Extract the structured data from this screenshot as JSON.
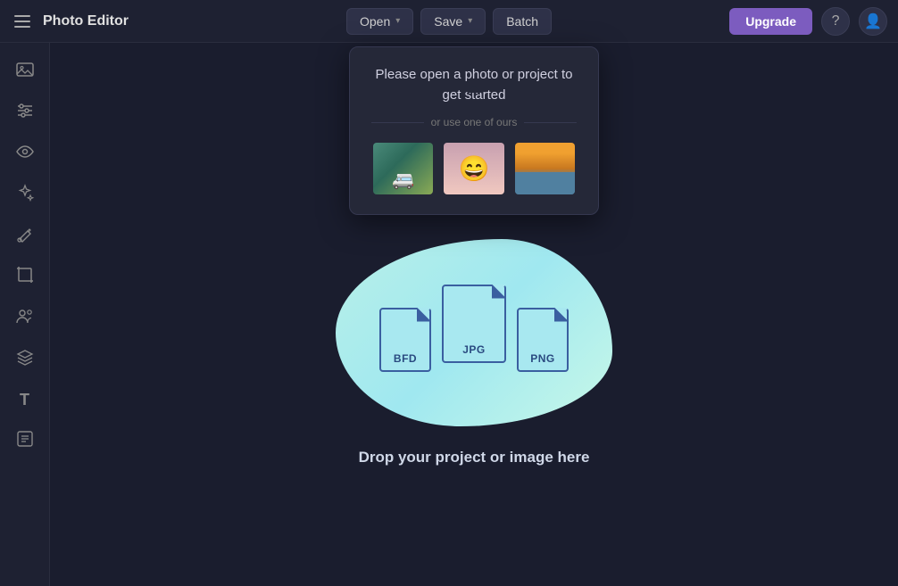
{
  "header": {
    "menu_icon": "☰",
    "title": "Photo Editor",
    "open_label": "Open",
    "save_label": "Save",
    "batch_label": "Batch",
    "upgrade_label": "Upgrade",
    "help_icon": "?",
    "account_icon": "👤"
  },
  "sidebar": {
    "items": [
      {
        "name": "image-icon",
        "icon": "🖼",
        "label": "Image"
      },
      {
        "name": "adjustments-icon",
        "icon": "⚙",
        "label": "Adjustments"
      },
      {
        "name": "eye-icon",
        "icon": "👁",
        "label": "View"
      },
      {
        "name": "magic-icon",
        "icon": "✦",
        "label": "Magic"
      },
      {
        "name": "paint-icon",
        "icon": "🖌",
        "label": "Paint"
      },
      {
        "name": "crop-icon",
        "icon": "⬜",
        "label": "Crop"
      },
      {
        "name": "people-icon",
        "icon": "👥",
        "label": "People"
      },
      {
        "name": "layers-icon",
        "icon": "⊞",
        "label": "Layers"
      },
      {
        "name": "text-icon",
        "icon": "T",
        "label": "Text"
      },
      {
        "name": "sticker-icon",
        "icon": "🗒",
        "label": "Sticker"
      }
    ]
  },
  "dropdown": {
    "main_text": "Please open a photo or project to get started",
    "divider_text": "or use one of ours",
    "samples": [
      {
        "name": "sample-van",
        "type": "van"
      },
      {
        "name": "sample-person",
        "type": "person"
      },
      {
        "name": "sample-canal",
        "type": "canal"
      }
    ]
  },
  "dropzone": {
    "files": [
      {
        "label": "BFD",
        "size": "small"
      },
      {
        "label": "JPG",
        "size": "medium"
      },
      {
        "label": "PNG",
        "size": "small"
      }
    ],
    "drop_text": "Drop your project or image here"
  }
}
